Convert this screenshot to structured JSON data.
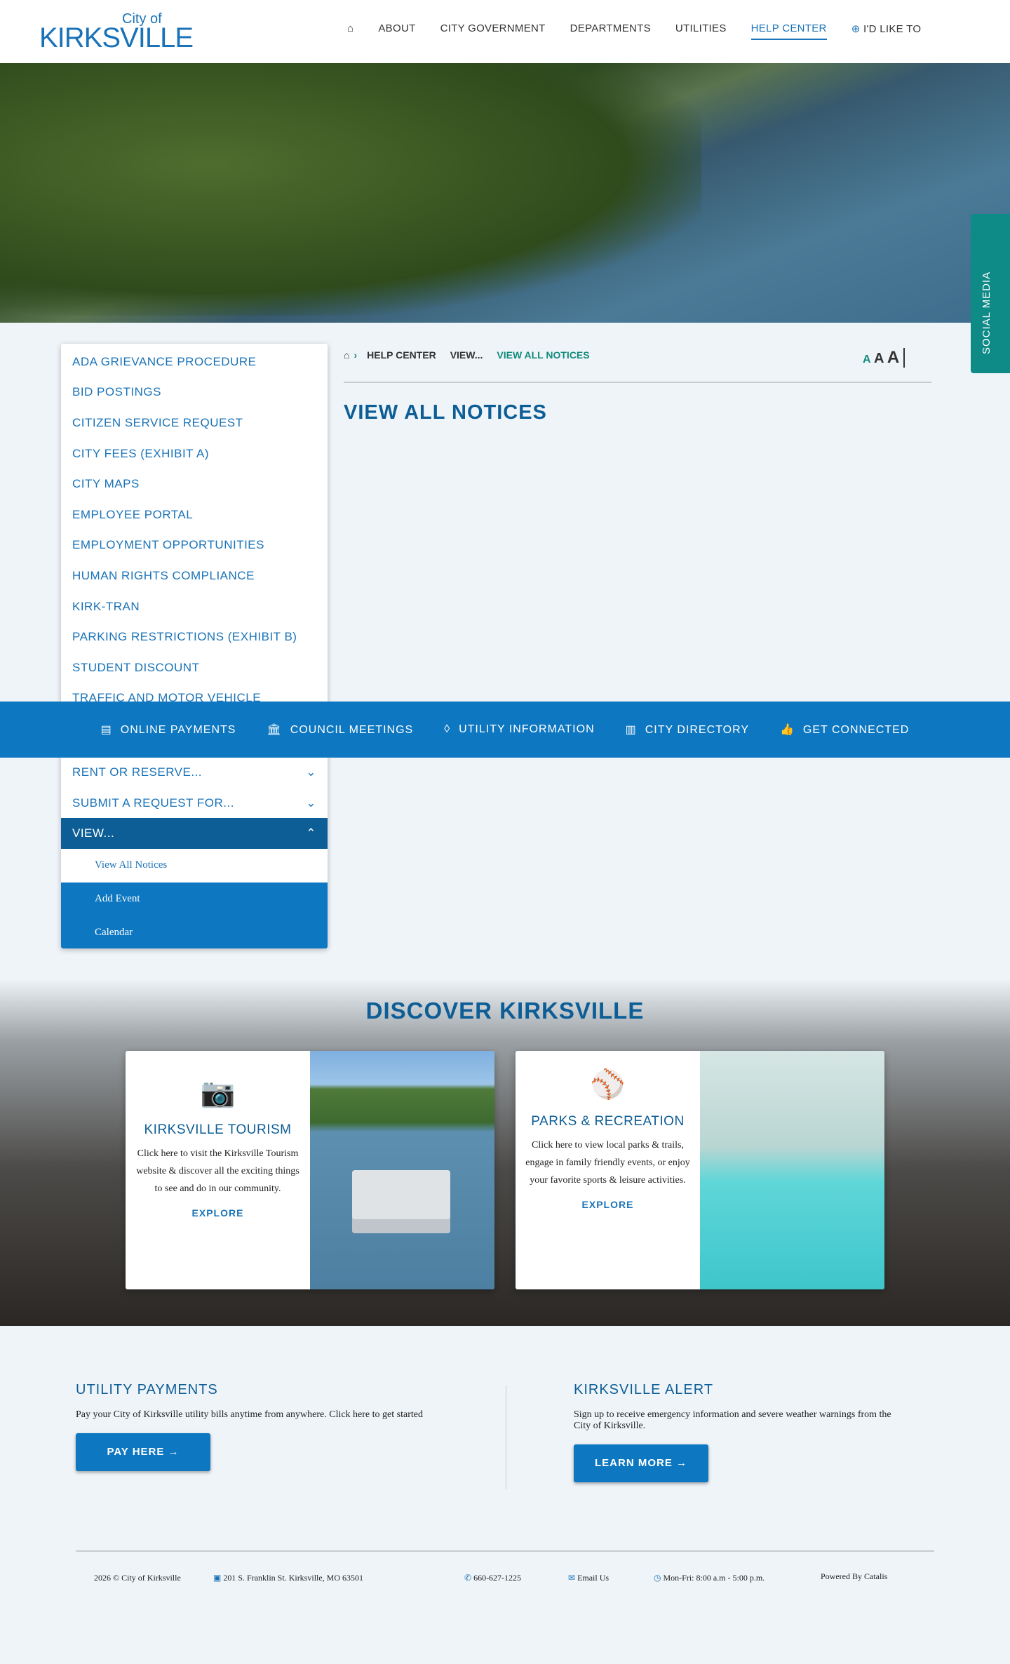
{
  "header": {
    "logo_small": "City of",
    "logo_name": "KIRKSVILLE",
    "nav": [
      "ABOUT",
      "CITY GOVERNMENT",
      "DEPARTMENTS",
      "UTILITIES",
      "HELP CENTER",
      "I'D LIKE TO"
    ]
  },
  "social": "SOCIAL MEDIA",
  "sidebar": {
    "items": [
      "ADA GRIEVANCE PROCEDURE",
      "BID POSTINGS",
      "CITIZEN SERVICE REQUEST",
      "CITY FEES (EXHIBIT A)",
      "CITY MAPS",
      "EMPLOYEE PORTAL",
      "EMPLOYMENT OPPORTUNITIES",
      "HUMAN RIGHTS COMPLIANCE",
      "KIRK-TRAN",
      "PARKING RESTRICTIONS (EXHIBIT B)",
      "STUDENT DISCOUNT",
      "TRAFFIC AND MOTOR VEHICLE"
    ],
    "rent": "RENT OR RESERVE...",
    "submit": "SUBMIT A REQUEST FOR...",
    "view": "VIEW...",
    "subitems": [
      "View All Notices",
      "Add Event",
      "Calendar"
    ]
  },
  "quicklinks": [
    "ONLINE PAYMENTS",
    "COUNCIL MEETINGS",
    "UTILITY INFORMATION",
    "CITY DIRECTORY",
    "GET CONNECTED"
  ],
  "breadcrumb": [
    "HELP CENTER",
    "VIEW...",
    "VIEW ALL NOTICES"
  ],
  "text_size": "A",
  "page_title": "VIEW ALL NOTICES",
  "discover": {
    "title": "DISCOVER KIRKSVILLE",
    "cards": [
      {
        "title": "KIRKSVILLE TOURISM",
        "text": "Click here to visit the Kirksville Tourism website & discover all the exciting things to see and do in our community.",
        "link": "EXPLORE"
      },
      {
        "title": "PARKS & RECREATION",
        "text": "Click here to view local parks & trails, engage in family friendly events, or enjoy your favorite sports & leisure activities.",
        "link": "EXPLORE"
      }
    ]
  },
  "utility": {
    "title": "UTILITY PAYMENTS",
    "text": "Pay your City of Kirksville utility bills anytime from anywhere. Click here to get started",
    "button": "PAY HERE →"
  },
  "alert": {
    "title": "KIRKSVILLE ALERT",
    "text": "Sign up to receive emergency information and severe weather warnings from the City of Kirksville.",
    "button": "LEARN MORE →"
  },
  "footer": {
    "copyright": "2026 © City of Kirksville",
    "address": "201 S. Franklin St. Kirksville, MO 63501",
    "phone": "660-627-1225",
    "email": "Email Us",
    "hours": "Mon-Fri: 8:00 a.m - 5:00 p.m.",
    "powered": "Powered By Catalis"
  }
}
